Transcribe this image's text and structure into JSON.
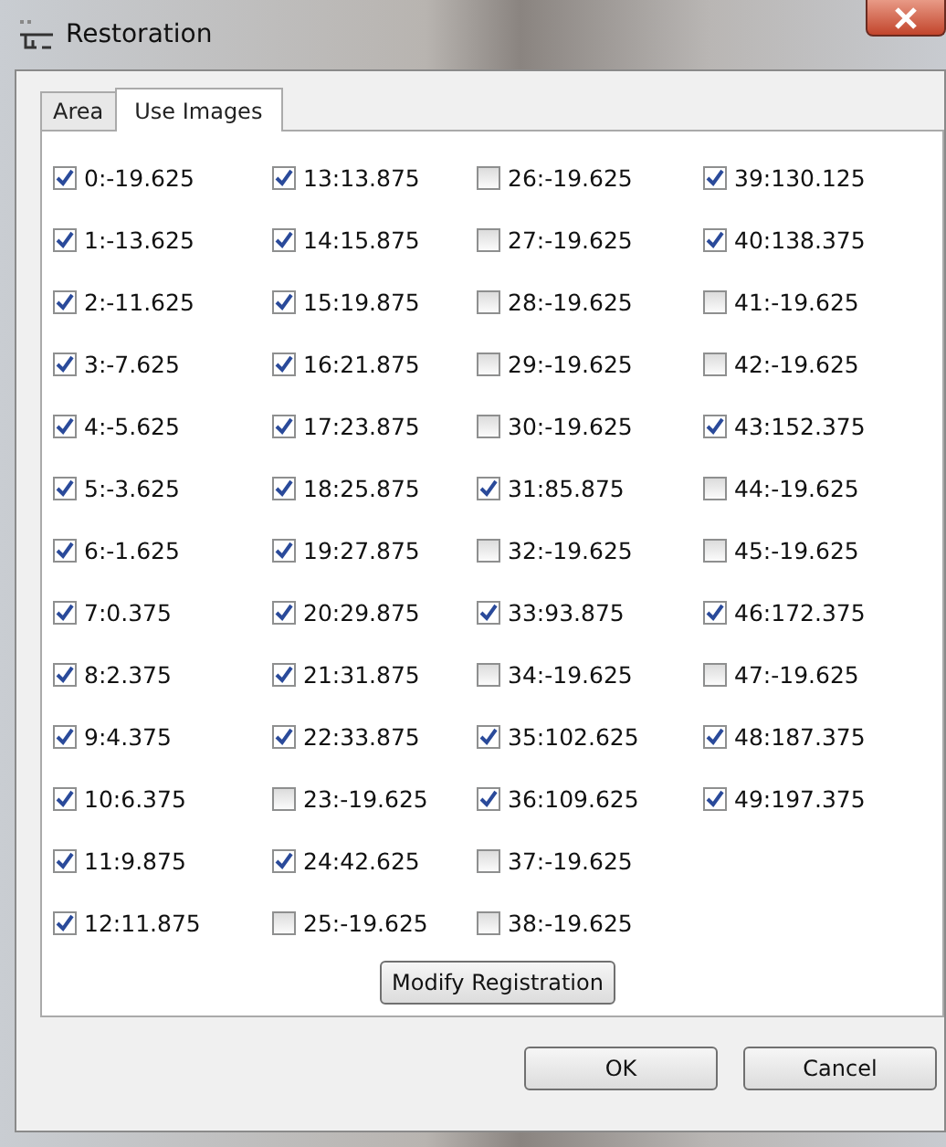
{
  "window": {
    "title": "Restoration"
  },
  "tabs": [
    {
      "label": "Area",
      "selected": false
    },
    {
      "label": "Use Images",
      "selected": true
    }
  ],
  "images": [
    {
      "label": "0:-19.625",
      "checked": true
    },
    {
      "label": "1:-13.625",
      "checked": true
    },
    {
      "label": "2:-11.625",
      "checked": true
    },
    {
      "label": "3:-7.625",
      "checked": true
    },
    {
      "label": "4:-5.625",
      "checked": true
    },
    {
      "label": "5:-3.625",
      "checked": true
    },
    {
      "label": "6:-1.625",
      "checked": true
    },
    {
      "label": "7:0.375",
      "checked": true
    },
    {
      "label": "8:2.375",
      "checked": true
    },
    {
      "label": "9:4.375",
      "checked": true
    },
    {
      "label": "10:6.375",
      "checked": true
    },
    {
      "label": "11:9.875",
      "checked": true
    },
    {
      "label": "12:11.875",
      "checked": true
    },
    {
      "label": "13:13.875",
      "checked": true
    },
    {
      "label": "14:15.875",
      "checked": true
    },
    {
      "label": "15:19.875",
      "checked": true
    },
    {
      "label": "16:21.875",
      "checked": true
    },
    {
      "label": "17:23.875",
      "checked": true
    },
    {
      "label": "18:25.875",
      "checked": true
    },
    {
      "label": "19:27.875",
      "checked": true
    },
    {
      "label": "20:29.875",
      "checked": true
    },
    {
      "label": "21:31.875",
      "checked": true
    },
    {
      "label": "22:33.875",
      "checked": true
    },
    {
      "label": "23:-19.625",
      "checked": false
    },
    {
      "label": "24:42.625",
      "checked": true
    },
    {
      "label": "25:-19.625",
      "checked": false
    },
    {
      "label": "26:-19.625",
      "checked": false
    },
    {
      "label": "27:-19.625",
      "checked": false
    },
    {
      "label": "28:-19.625",
      "checked": false
    },
    {
      "label": "29:-19.625",
      "checked": false
    },
    {
      "label": "30:-19.625",
      "checked": false
    },
    {
      "label": "31:85.875",
      "checked": true
    },
    {
      "label": "32:-19.625",
      "checked": false
    },
    {
      "label": "33:93.875",
      "checked": true
    },
    {
      "label": "34:-19.625",
      "checked": false
    },
    {
      "label": "35:102.625",
      "checked": true
    },
    {
      "label": "36:109.625",
      "checked": true
    },
    {
      "label": "37:-19.625",
      "checked": false
    },
    {
      "label": "38:-19.625",
      "checked": false
    },
    {
      "label": "39:130.125",
      "checked": true
    },
    {
      "label": "40:138.375",
      "checked": true
    },
    {
      "label": "41:-19.625",
      "checked": false
    },
    {
      "label": "42:-19.625",
      "checked": false
    },
    {
      "label": "43:152.375",
      "checked": true
    },
    {
      "label": "44:-19.625",
      "checked": false
    },
    {
      "label": "45:-19.625",
      "checked": false
    },
    {
      "label": "46:172.375",
      "checked": true
    },
    {
      "label": "47:-19.625",
      "checked": false
    },
    {
      "label": "48:187.375",
      "checked": true
    },
    {
      "label": "49:197.375",
      "checked": true
    }
  ],
  "panel_button": "Modify Registration",
  "buttons": [
    "OK",
    "Cancel"
  ]
}
